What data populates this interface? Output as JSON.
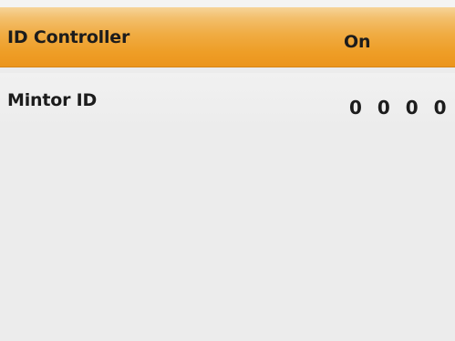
{
  "menu": {
    "items": [
      {
        "label": "ID Controller",
        "value": "On",
        "selected": true
      },
      {
        "label": "Mintor ID",
        "value": "0 0 0 0",
        "selected": false
      }
    ]
  },
  "colors": {
    "highlight": "#f0ac43",
    "background": "#ececec",
    "text": "#1c1c1c"
  }
}
